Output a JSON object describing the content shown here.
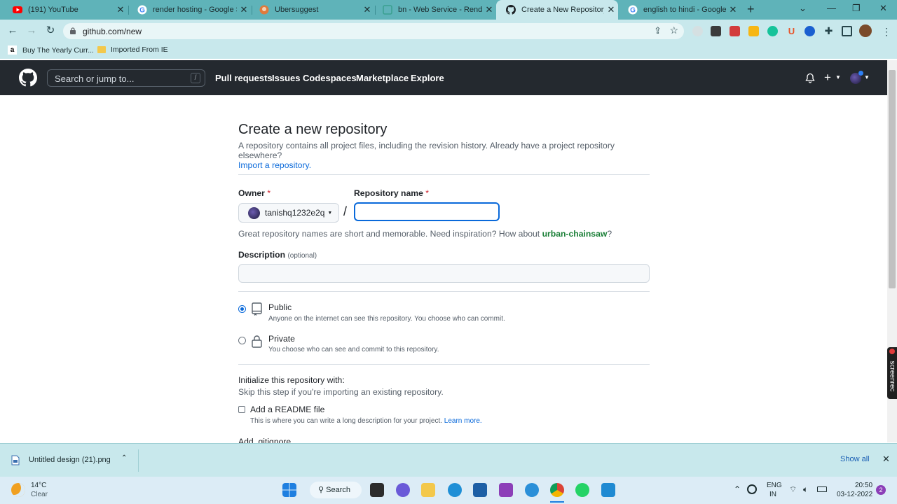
{
  "browser": {
    "tabs": [
      {
        "label": "(191) YouTube",
        "icon": "youtube-icon"
      },
      {
        "label": "render hosting - Google Se",
        "icon": "google-icon"
      },
      {
        "label": "Ubersuggest",
        "icon": "ubersuggest-icon"
      },
      {
        "label": "bn - Web Service - Render",
        "icon": "render-icon"
      },
      {
        "label": "Create a New Repository",
        "icon": "github-icon"
      },
      {
        "label": "english to hindi - Google Se",
        "icon": "google-icon"
      }
    ],
    "url": "github.com/new",
    "bookmarks": [
      {
        "label": "Buy The Yearly Curr..."
      },
      {
        "label": "Imported From IE"
      }
    ]
  },
  "github": {
    "search_placeholder": "Search or jump to...",
    "slash_key": "/",
    "nav": [
      "Pull requests",
      "Issues",
      "Codespaces",
      "Marketplace",
      "Explore"
    ],
    "plus": "+"
  },
  "form": {
    "title": "Create a new repository",
    "lead": "A repository contains all project files, including the revision history. Already have a project repository elsewhere?",
    "import_link": "Import a repository.",
    "owner_label": "Owner",
    "required_mark": "*",
    "owner_value": "tanishq1232e2q",
    "separator": "/",
    "repo_label": "Repository name",
    "repo_value": "",
    "hint_prefix": "Great repository names are short and memorable. Need inspiration? How about ",
    "hint_suggestion": "urban-chainsaw",
    "hint_suffix": "?",
    "desc_label": "Description",
    "desc_optional": "(optional)",
    "desc_value": "",
    "visibility": [
      {
        "title": "Public",
        "subtitle": "Anyone on the internet can see this repository. You choose who can commit.",
        "selected": true
      },
      {
        "title": "Private",
        "subtitle": "You choose who can see and commit to this repository.",
        "selected": false
      }
    ],
    "init_title": "Initialize this repository with:",
    "init_sub": "Skip this step if you're importing an existing repository.",
    "readme_label": "Add a README file",
    "readme_sub": "This is where you can write a long description for your project.",
    "learn_more": "Learn more.",
    "gitignore_label": "Add .gitignore"
  },
  "download_bar": {
    "file": "Untitled design (21).png",
    "show_all": "Show all"
  },
  "taskbar": {
    "weather_temp": "14°C",
    "weather_desc": "Clear",
    "search": "Search",
    "lang_top": "ENG",
    "lang_bottom": "IN",
    "time": "20:50",
    "date": "03-12-2022",
    "notif_count": "2"
  },
  "side_widget": "screenrec"
}
